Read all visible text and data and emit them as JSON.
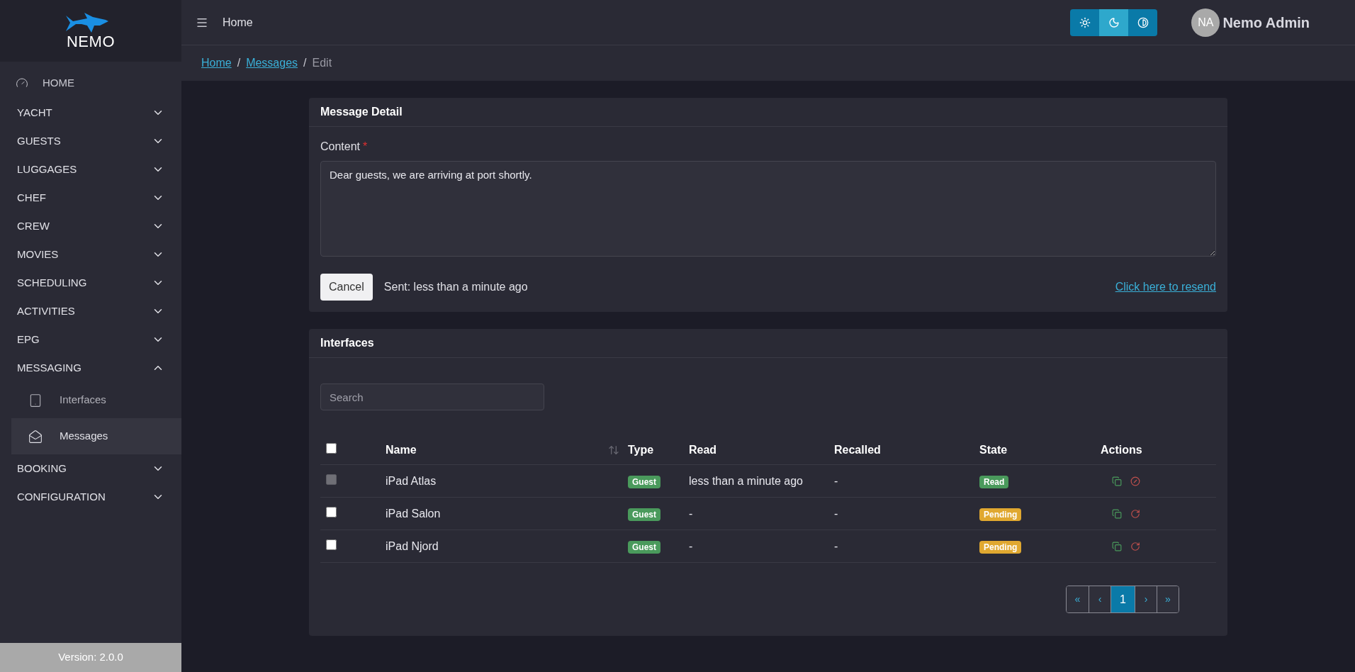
{
  "sidebar": {
    "logo_text": "NEMO",
    "items": [
      {
        "label": "HOME",
        "kind": "link"
      },
      {
        "label": "YACHT",
        "kind": "group",
        "expanded": false
      },
      {
        "label": "GUESTS",
        "kind": "group",
        "expanded": false
      },
      {
        "label": "LUGGAGES",
        "kind": "group",
        "expanded": false
      },
      {
        "label": "CHEF",
        "kind": "group",
        "expanded": false
      },
      {
        "label": "CREW",
        "kind": "group",
        "expanded": false
      },
      {
        "label": "MOVIES",
        "kind": "group",
        "expanded": false
      },
      {
        "label": "SCHEDULING",
        "kind": "group",
        "expanded": false
      },
      {
        "label": "ACTIVITIES",
        "kind": "group",
        "expanded": false
      },
      {
        "label": "EPG",
        "kind": "group",
        "expanded": false
      },
      {
        "label": "MESSAGING",
        "kind": "group",
        "expanded": true,
        "children": [
          {
            "label": "Interfaces",
            "kind": "device",
            "selected": false
          },
          {
            "label": "Messages",
            "kind": "mail",
            "selected": true
          }
        ]
      },
      {
        "label": "BOOKING",
        "kind": "group",
        "expanded": false
      },
      {
        "label": "CONFIGURATION",
        "kind": "group",
        "expanded": false
      }
    ],
    "version": "Version: 2.0.0"
  },
  "header": {
    "title": "Home",
    "theme_buttons": [
      {
        "kind": "light",
        "selected": false
      },
      {
        "kind": "dark",
        "selected": true
      },
      {
        "kind": "contrast",
        "selected": false
      }
    ],
    "avatar": "NA",
    "user": "Nemo Admin"
  },
  "breadcrumb": [
    {
      "label": "Home",
      "link": true
    },
    {
      "separator": "/",
      "label": "Messages",
      "link": true
    },
    {
      "separator": "/",
      "label": "Edit",
      "link": false
    }
  ],
  "message_detail": {
    "title": "Message Detail",
    "content_label": "Content",
    "required_mark": "*",
    "content": "Dear guests, we are arriving at port shortly.",
    "cancel": "Cancel",
    "sent": "Sent: less than a minute ago",
    "resend": "Click here to resend"
  },
  "interfaces": {
    "title": "Interfaces",
    "search_placeholder": "Search",
    "columns": [
      "Name",
      "Type",
      "Read",
      "Recalled",
      "State",
      "Actions"
    ],
    "header_checked": false,
    "rows": [
      {
        "checked": false,
        "disabled": true,
        "name": "iPad Atlas",
        "type": "Guest",
        "read": "less than a minute ago",
        "recalled": "-",
        "state": {
          "label": "Read",
          "kind": "read"
        },
        "actions": [
          {
            "kind": "copy"
          },
          {
            "kind": "recall"
          }
        ]
      },
      {
        "checked": false,
        "disabled": false,
        "name": "iPad Salon",
        "type": "Guest",
        "read": "-",
        "recalled": "-",
        "state": {
          "label": "Pending",
          "kind": "pending"
        },
        "actions": [
          {
            "kind": "copy"
          },
          {
            "kind": "resend"
          }
        ]
      },
      {
        "checked": false,
        "disabled": false,
        "name": "iPad Njord",
        "type": "Guest",
        "read": "-",
        "recalled": "-",
        "state": {
          "label": "Pending",
          "kind": "pending"
        },
        "actions": [
          {
            "kind": "copy"
          },
          {
            "kind": "resend"
          }
        ]
      }
    ],
    "pagination": [
      {
        "label": "«",
        "selected": false
      },
      {
        "label": "‹",
        "selected": false
      },
      {
        "label": "1",
        "selected": true
      },
      {
        "label": "›",
        "selected": false
      },
      {
        "label": "»",
        "selected": false
      }
    ]
  }
}
